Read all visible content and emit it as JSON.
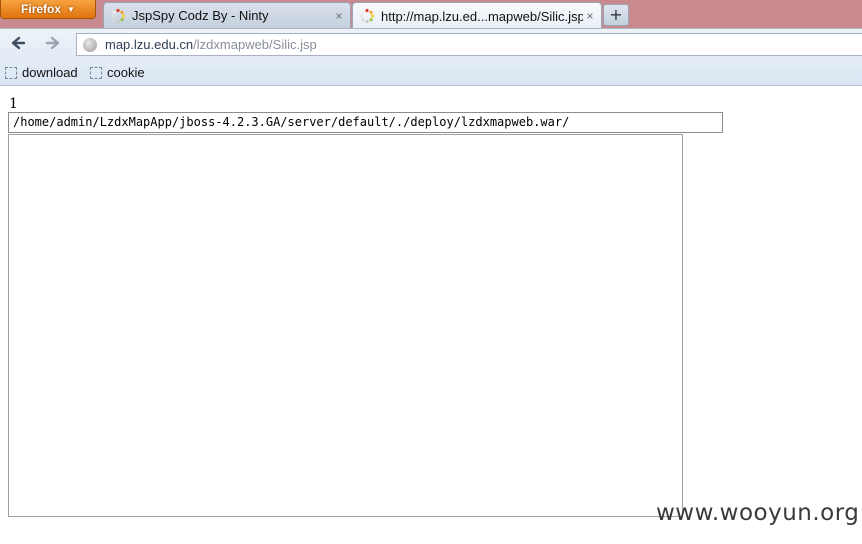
{
  "browser": {
    "menu_label": "Firefox",
    "new_tab_label": "+",
    "tabs": [
      {
        "title": "JspSpy Codz By - Ninty",
        "close": "×"
      },
      {
        "title": "http://map.lzu.ed...mapweb/Silic.jsp",
        "close": "×"
      }
    ],
    "url": {
      "host": "map.lzu.edu.cn",
      "path": "/lzdxmapweb/Silic.jsp"
    },
    "bookmarks": [
      {
        "label": "download"
      },
      {
        "label": "cookie"
      }
    ]
  },
  "page": {
    "line1": "1",
    "path_value": "/home/admin/LzdxMapApp/jboss-4.2.3.GA/server/default/./deploy/lzdxmapweb.war/",
    "content_value": ""
  },
  "watermark": "www.wooyun.org",
  "colors": {
    "titlebar": "#c88a8f",
    "firefox_button": "#e8821a"
  }
}
